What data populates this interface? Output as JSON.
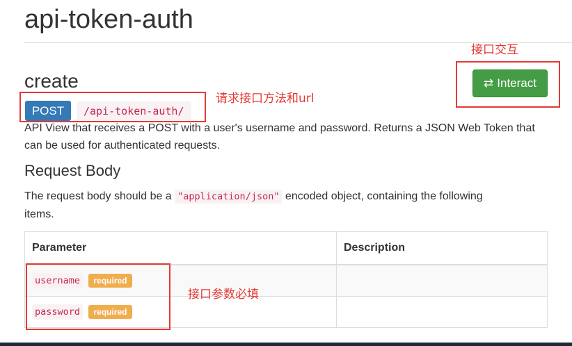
{
  "page_title": "api-token-auth",
  "section": {
    "title": "create",
    "interact_label": "Interact",
    "interact_icon": "swap-arrows-icon",
    "method": "POST",
    "url": "/api-token-auth/",
    "description": "API View that receives a POST with a user's username and password. Returns a JSON Web Token that can be used for authenticated requests."
  },
  "request_body": {
    "title": "Request Body",
    "text_before": "The request body should be a ",
    "content_type": "\"application/json\"",
    "text_after": " encoded object, containing the following items."
  },
  "params_table": {
    "headers": [
      "Parameter",
      "Description"
    ],
    "rows": [
      {
        "name": "username",
        "badge": "required",
        "description": ""
      },
      {
        "name": "password",
        "badge": "required",
        "description": ""
      }
    ]
  },
  "annotations": {
    "interact": "接口交互",
    "method_url": "请求接口方法和url",
    "params": "接口参数必填"
  },
  "colors": {
    "annotation_red": "#e53935",
    "interact_green": "#449d44",
    "post_blue": "#337ab7",
    "required_orange": "#f0ad4e",
    "code_pink": "#c7254e"
  }
}
